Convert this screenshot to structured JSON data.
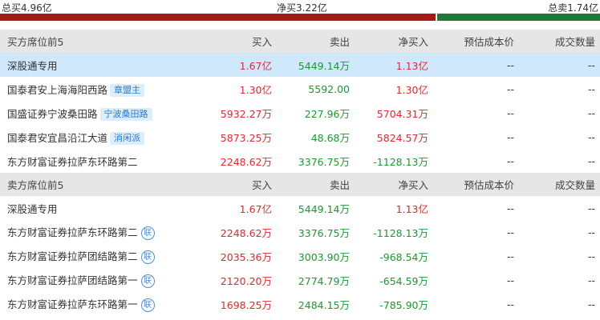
{
  "summary": {
    "total_buy": "总买4.96亿",
    "net_buy": "净买3.22亿",
    "total_sell": "总卖1.74亿",
    "buy_color": "#a31a1a",
    "sell_color": "#1e7a3a"
  },
  "buy_section": {
    "headers": [
      "买方席位前5",
      "买入",
      "卖出",
      "净买入",
      "预估成本价",
      "成交数量"
    ],
    "rows": [
      {
        "name": "深股通专用",
        "tag": "",
        "buy": "1.67亿",
        "sell": "5449.14万",
        "net": "1.13亿",
        "cost": "--",
        "volume": "--"
      },
      {
        "name": "国泰君安上海海阳西路",
        "tag": "章盟主",
        "buy": "1.30亿",
        "sell": "5592.00",
        "net": "1.30亿",
        "cost": "--",
        "volume": "--"
      },
      {
        "name": "国盛证券宁波桑田路",
        "tag": "宁波桑田路",
        "buy": "5932.27万",
        "sell": "227.96万",
        "net": "5704.31万",
        "cost": "--",
        "volume": "--"
      },
      {
        "name": "国泰君安宜昌沿江大道",
        "tag": "消闲派",
        "buy": "5873.25万",
        "sell": "48.68万",
        "net": "5824.57万",
        "cost": "--",
        "volume": "--"
      },
      {
        "name": "东方财富证券拉萨东环路第二",
        "tag": "",
        "buy": "2248.62万",
        "sell": "3376.75万",
        "net": "-1128.13万",
        "cost": "--",
        "volume": "--"
      }
    ]
  },
  "sell_section": {
    "headers": [
      "卖方席位前5",
      "买入",
      "卖出",
      "净买入",
      "预估成本价",
      "成交数量"
    ],
    "rows": [
      {
        "name": "深股通专用",
        "badge": "",
        "buy": "1.67亿",
        "sell": "5449.14万",
        "net": "1.13亿",
        "cost": "--",
        "volume": "--"
      },
      {
        "name": "东方财富证券拉萨东环路第二",
        "badge": "联",
        "buy": "2248.62万",
        "sell": "3376.75万",
        "net": "-1128.13万",
        "cost": "--",
        "volume": "--"
      },
      {
        "name": "东方财富证券拉萨团结路第二",
        "badge": "联",
        "buy": "2035.36万",
        "sell": "3003.90万",
        "net": "-968.54万",
        "cost": "--",
        "volume": "--"
      },
      {
        "name": "东方财富证券拉萨团结路第一",
        "badge": "联",
        "buy": "2120.20万",
        "sell": "2774.79万",
        "net": "-654.59万",
        "cost": "--",
        "volume": "--"
      },
      {
        "name": "东方财富证券拉萨东环路第一",
        "badge": "联",
        "buy": "1698.25万",
        "sell": "2484.15万",
        "net": "-785.90万",
        "cost": "--",
        "volume": "--"
      }
    ]
  },
  "colors": {
    "positive": "#e8262b",
    "negative": "#1a9b2e",
    "highlight_row": "#cfe8fb",
    "header_bg": "#e6e6e6"
  }
}
